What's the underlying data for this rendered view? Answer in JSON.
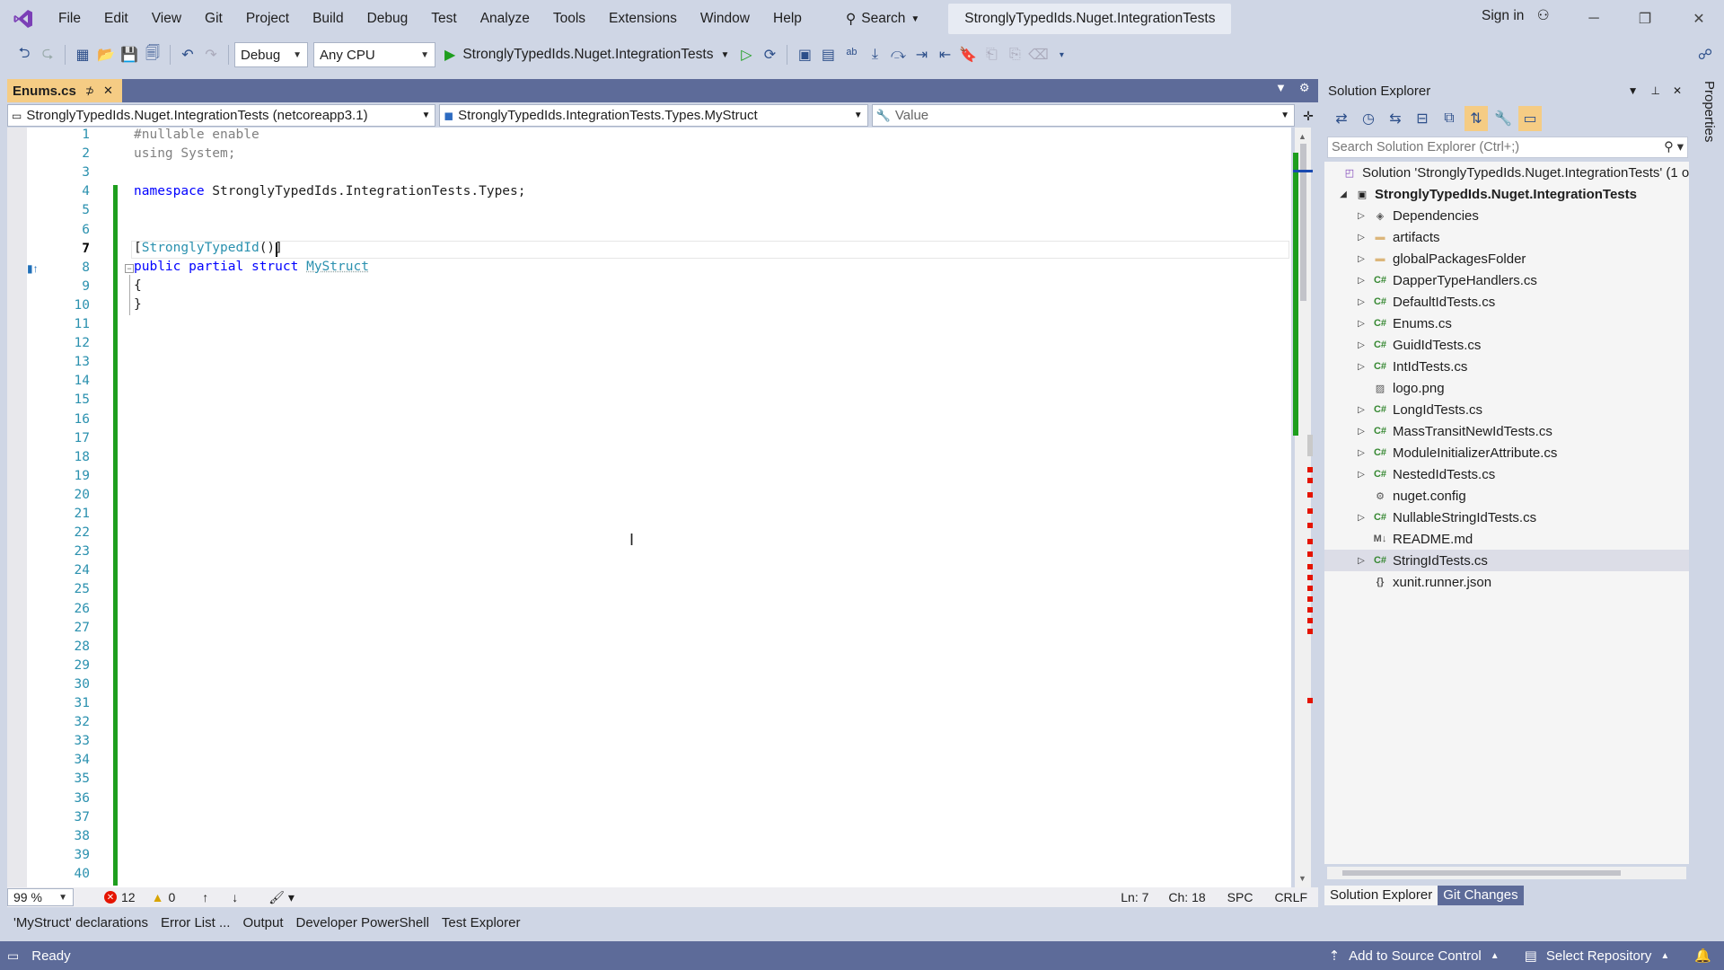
{
  "menu": [
    "File",
    "Edit",
    "View",
    "Git",
    "Project",
    "Build",
    "Debug",
    "Test",
    "Analyze",
    "Tools",
    "Extensions",
    "Window",
    "Help"
  ],
  "search_label": "Search",
  "solution_title": "StronglyTypedIds.Nuget.IntegrationTests",
  "sign_in": "Sign in",
  "toolbar": {
    "config": "Debug",
    "platform": "Any CPU",
    "run_target": "StronglyTypedIds.Nuget.IntegrationTests"
  },
  "doc_tab": {
    "label": "Enums.cs"
  },
  "navbar": {
    "project": "StronglyTypedIds.Nuget.IntegrationTests (netcoreapp3.1)",
    "type": "StronglyTypedIds.IntegrationTests.Types.MyStruct",
    "member": "Value"
  },
  "editor": {
    "line_numbers": [
      "1",
      "2",
      "3",
      "4",
      "5",
      "6",
      "7",
      "8",
      "9",
      "10",
      "11",
      "12",
      "13",
      "14",
      "15",
      "16",
      "17",
      "18",
      "19",
      "20",
      "21",
      "22",
      "23",
      "24",
      "25",
      "26",
      "27",
      "28",
      "29",
      "30",
      "31",
      "32",
      "33",
      "34",
      "35",
      "36",
      "37",
      "38",
      "39",
      "40"
    ],
    "code": {
      "l1": "#nullable enable",
      "l2_kw": "using",
      "l2_rest": " System;",
      "l4_kw": "namespace",
      "l4_rest": " StronglyTypedIds.IntegrationTests.Types;",
      "l7_open": "[",
      "l7_attr": "StronglyTypedId",
      "l7_close": "()]",
      "l8_kw1": "public",
      "l8_kw2": "partial",
      "l8_kw3": "struct",
      "l8_type": "MyStruct",
      "l9": "{",
      "l10": "}"
    }
  },
  "editor_status": {
    "zoom": "99 %",
    "errors": "12",
    "warnings": "0",
    "line": "Ln: 7",
    "char": "Ch: 18",
    "spc": "SPC",
    "crlf": "CRLF"
  },
  "solution_explorer": {
    "title": "Solution Explorer",
    "search_placeholder": "Search Solution Explorer (Ctrl+;)",
    "solution_node": "Solution 'StronglyTypedIds.Nuget.IntegrationTests' (1 o",
    "project_node": "StronglyTypedIds.Nuget.IntegrationTests",
    "items": [
      {
        "label": "Dependencies",
        "expandable": true,
        "icon": "dependencies-icon"
      },
      {
        "label": "artifacts",
        "expandable": true,
        "icon": "folder-icon"
      },
      {
        "label": "globalPackagesFolder",
        "expandable": true,
        "icon": "folder-icon"
      },
      {
        "label": "DapperTypeHandlers.cs",
        "expandable": true,
        "icon": "csharp-file-icon"
      },
      {
        "label": "DefaultIdTests.cs",
        "expandable": true,
        "icon": "csharp-file-icon"
      },
      {
        "label": "Enums.cs",
        "expandable": true,
        "icon": "csharp-file-icon"
      },
      {
        "label": "GuidIdTests.cs",
        "expandable": true,
        "icon": "csharp-file-icon"
      },
      {
        "label": "IntIdTests.cs",
        "expandable": true,
        "icon": "csharp-file-icon"
      },
      {
        "label": "logo.png",
        "expandable": false,
        "icon": "image-file-icon"
      },
      {
        "label": "LongIdTests.cs",
        "expandable": true,
        "icon": "csharp-file-icon"
      },
      {
        "label": "MassTransitNewIdTests.cs",
        "expandable": true,
        "icon": "csharp-file-icon"
      },
      {
        "label": "ModuleInitializerAttribute.cs",
        "expandable": true,
        "icon": "csharp-file-icon"
      },
      {
        "label": "NestedIdTests.cs",
        "expandable": true,
        "icon": "csharp-file-icon"
      },
      {
        "label": "nuget.config",
        "expandable": false,
        "icon": "config-file-icon"
      },
      {
        "label": "NullableStringIdTests.cs",
        "expandable": true,
        "icon": "csharp-file-icon"
      },
      {
        "label": "README.md",
        "expandable": false,
        "icon": "markdown-file-icon"
      },
      {
        "label": "StringIdTests.cs",
        "expandable": true,
        "icon": "csharp-file-icon",
        "selected": true
      },
      {
        "label": "xunit.runner.json",
        "expandable": false,
        "icon": "json-file-icon"
      }
    ],
    "tabs": [
      "Solution Explorer",
      "Git Changes"
    ]
  },
  "properties_label": "Properties",
  "bottom_tabs": [
    "'MyStruct' declarations",
    "Error List ...",
    "Output",
    "Developer PowerShell",
    "Test Explorer"
  ],
  "status": {
    "ready": "Ready",
    "add_source": "Add to Source Control",
    "select_repo": "Select Repository"
  },
  "colors": {
    "accent": "#5d6b99",
    "tab_active": "#f5cc84",
    "keyword": "#0000ff",
    "type": "#2b91af",
    "change_bar": "#1e9e1e"
  }
}
